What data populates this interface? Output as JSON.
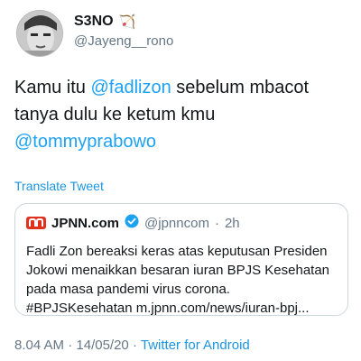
{
  "author": {
    "display_name": "S3NO",
    "name_emoji": "🏹",
    "handle": "@Jayeng__rono"
  },
  "tweet": {
    "text_1": "Kamu itu ",
    "mention_1": "@fadlizon",
    "text_2": " sebelum mbacot tanya dulu ke ketum kmu ",
    "mention_2": "@tommyprabowo"
  },
  "translate_label": "Translate Tweet",
  "quoted": {
    "logo": "JPNN logo",
    "name": "JPNN.com",
    "verified_icon": "verified-badge",
    "handle": "@jpnncom",
    "separator": "·",
    "time": "2h",
    "body": "Fadli Zon bereaksi keras atas keputusan Presiden Jokowi menaikkan besaran iuran BPJS Kesehatan pada masa pandemi virus corona. #BPJSKesehatan m.jpnn.com/news/iuran-bpj..."
  },
  "meta": {
    "time": "8.04 AM",
    "separator": "·",
    "date": "14/05/20",
    "separator_2": "·",
    "source": "Twitter for Android"
  },
  "colors": {
    "link": "#1da1f2",
    "secondary_text": "#657786",
    "jpnn_red": "#e0301e",
    "border": "#ccd6dd"
  }
}
